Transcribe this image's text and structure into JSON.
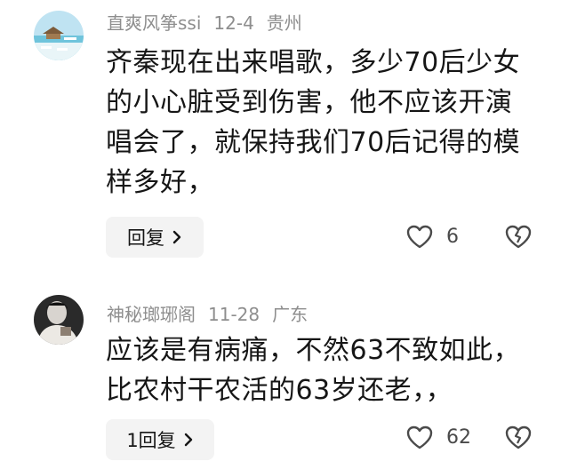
{
  "comments": [
    {
      "username": "直爽风筝ssi",
      "date": "12-4",
      "location": "贵州",
      "lines": [
        "齐秦现在出来唱歌，多少70后少女",
        "的小心脏受到伤害，他不应该开演",
        "唱会了，就保持我们70后记得的模",
        "样多好，"
      ],
      "reply_label": "回复",
      "like_count": "6",
      "avatar_icon": "beach-chairs-avatar"
    },
    {
      "username": "神秘瑯琊阁",
      "date": "11-28",
      "location": "广东",
      "lines": [
        "应该是有病痛，不然63不致如此，",
        "比农村干农活的63岁还老，，"
      ],
      "reply_label": "1回复",
      "like_count": "62",
      "avatar_icon": "man-portrait-avatar"
    }
  ],
  "colors": {
    "meta": "#8e8e8e",
    "text": "#161616",
    "button_bg": "#f3f3f3"
  }
}
